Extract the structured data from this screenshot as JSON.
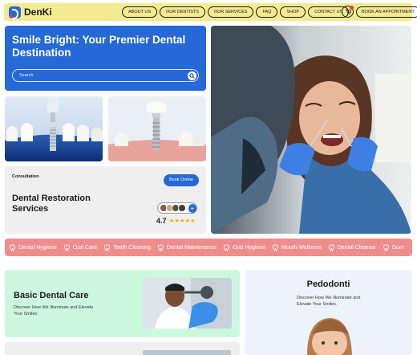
{
  "brand": {
    "name": "DenKi",
    "primary_color": "#2568d6",
    "header_color": "#f4ea92"
  },
  "nav": {
    "items": [
      "ABOUT US",
      "OUR DENTISTS",
      "OUR SERVICES",
      "FAQ",
      "SHOP",
      "CONTACT US"
    ],
    "cart_icon": "cart-icon",
    "appointment_label": "BOOK AN APPOINTMENT"
  },
  "hero": {
    "title": "Smile Bright: Your Premier Dental Destination",
    "search_placeholder": "Search",
    "search_icon": "search-icon"
  },
  "card": {
    "kicker": "Consultation",
    "book_label": "Book Online",
    "title": "Dental Restoration Services",
    "rating": "4.7",
    "stars": "★★★★★",
    "avatar_plus": "+"
  },
  "marquee": {
    "color": "#ef8d8d",
    "items": [
      "Dental Hygiene",
      "Oral Care",
      "Teeth Cleaning",
      "Dental Maintenance",
      "Oral Hygiene",
      "Mouth Wellness",
      "Dental Cleanse",
      "Gum"
    ]
  },
  "basic_care": {
    "title": "Basic Dental Care",
    "description": "Discover How We Illuminate and Elevate Your Smiles.",
    "color": "#ccf8df"
  },
  "pedodonti": {
    "title": "Pedodonti",
    "description": "Discover How We Illuminate and Elevate Your Smiles."
  }
}
